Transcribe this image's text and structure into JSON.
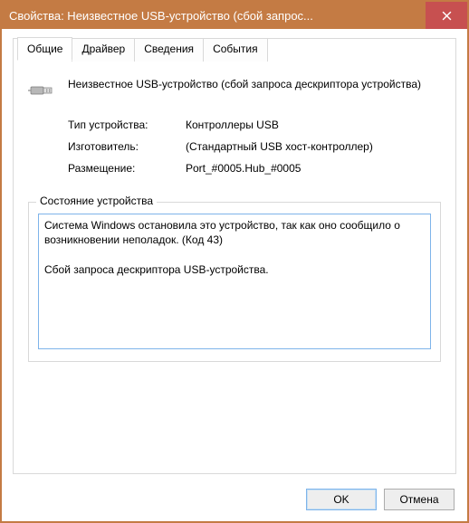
{
  "window": {
    "title": "Свойства: Неизвестное USB-устройство (сбой запрос..."
  },
  "tabs": {
    "general": "Общие",
    "driver": "Драйвер",
    "details": "Сведения",
    "events": "События"
  },
  "device": {
    "name": "Неизвестное USB-устройство (сбой запроса дескриптора устройства)"
  },
  "props": {
    "type_label": "Тип устройства:",
    "type_value": "Контроллеры USB",
    "mfg_label": "Изготовитель:",
    "mfg_value": "(Стандартный USB хост-контроллер)",
    "loc_label": "Размещение:",
    "loc_value": "Port_#0005.Hub_#0005"
  },
  "status": {
    "group_label": "Состояние устройства",
    "text": "Система Windows остановила это устройство, так как оно сообщило о возникновении неполадок. (Код 43)\n\nСбой запроса дескриптора USB-устройства."
  },
  "buttons": {
    "ok": "OK",
    "cancel": "Отмена"
  }
}
